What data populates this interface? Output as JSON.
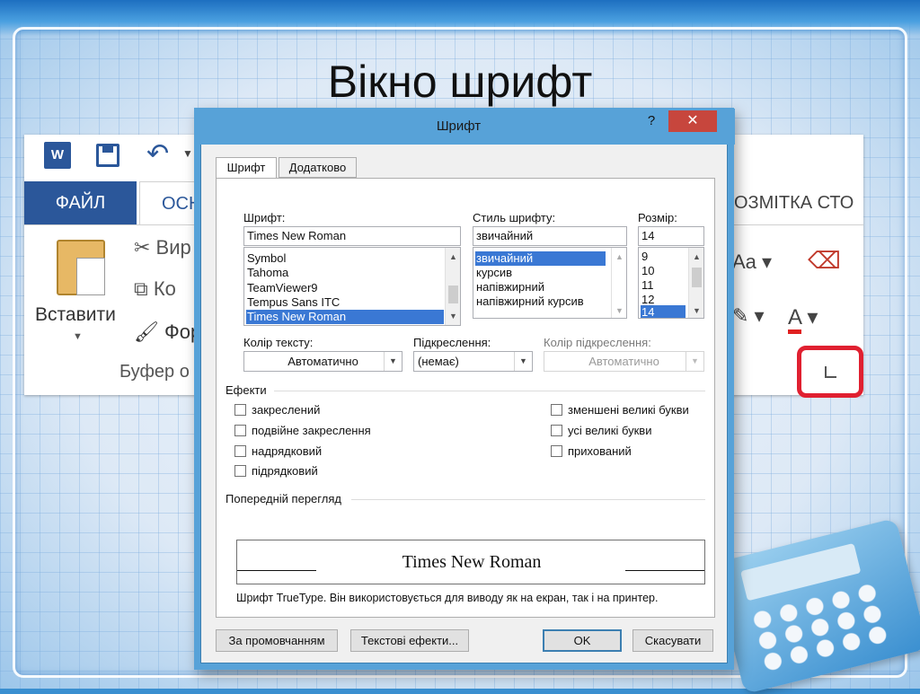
{
  "slide": {
    "title": "Вікно шрифт"
  },
  "ribbon": {
    "word_logo": "W",
    "tab_file": "ФАЙЛ",
    "tab_home": "ОСН",
    "tab_layout": "ОЗМІТКА СТО",
    "paste_label": "Вставити",
    "cut_label": "Вир",
    "copy_label": "Ко",
    "format_label": "Фор",
    "clipboard_group": "Буфер о",
    "font_size_icon": "Aa"
  },
  "dialog": {
    "title": "Шрифт",
    "help": "?",
    "close": "✕",
    "tabs": [
      {
        "label": "Шрифт",
        "active": true
      },
      {
        "label": "Додатково",
        "active": false
      }
    ],
    "font": {
      "label": "Шрифт:",
      "value": "Times New Roman",
      "items": [
        "Symbol",
        "Tahoma",
        "TeamViewer9",
        "Tempus Sans ITC",
        "Times New Roman"
      ],
      "selected_index": 4
    },
    "style": {
      "label": "Стиль шрифту:",
      "value": "звичайний",
      "items": [
        "звичайний",
        "курсив",
        "напівжирний",
        "напівжирний курсив"
      ],
      "selected_index": 0
    },
    "size": {
      "label": "Розмір:",
      "value": "14",
      "items": [
        "9",
        "10",
        "11",
        "12",
        "14"
      ],
      "selected_index": 4
    },
    "text_color": {
      "label": "Колір тексту:",
      "value": "Автоматично"
    },
    "underline": {
      "label": "Підкреслення:",
      "value": "(немає)"
    },
    "underline_color": {
      "label": "Колір підкреслення:",
      "value": "Автоматично"
    },
    "effects": {
      "label": "Ефекти",
      "left": [
        "закреслений",
        "подвійне закреслення",
        "надрядковий",
        "підрядковий"
      ],
      "right": [
        "зменшені великі букви",
        "усі великі букви",
        "прихований"
      ]
    },
    "preview": {
      "label": "Попередній перегляд",
      "sample": "Times New Roman",
      "note": "Шрифт TrueType. Він використовується для виводу як на екран, так і на принтер."
    },
    "buttons": {
      "default": "За промовчанням",
      "text_effects": "Текстові ефекти...",
      "ok": "OK",
      "cancel": "Скасувати"
    }
  },
  "colors": {
    "dialog_frame": "#57a2d8",
    "close_button": "#c7463d",
    "selection": "#3a78d4",
    "highlight_box": "#e02030",
    "word_blue": "#2b579a"
  }
}
